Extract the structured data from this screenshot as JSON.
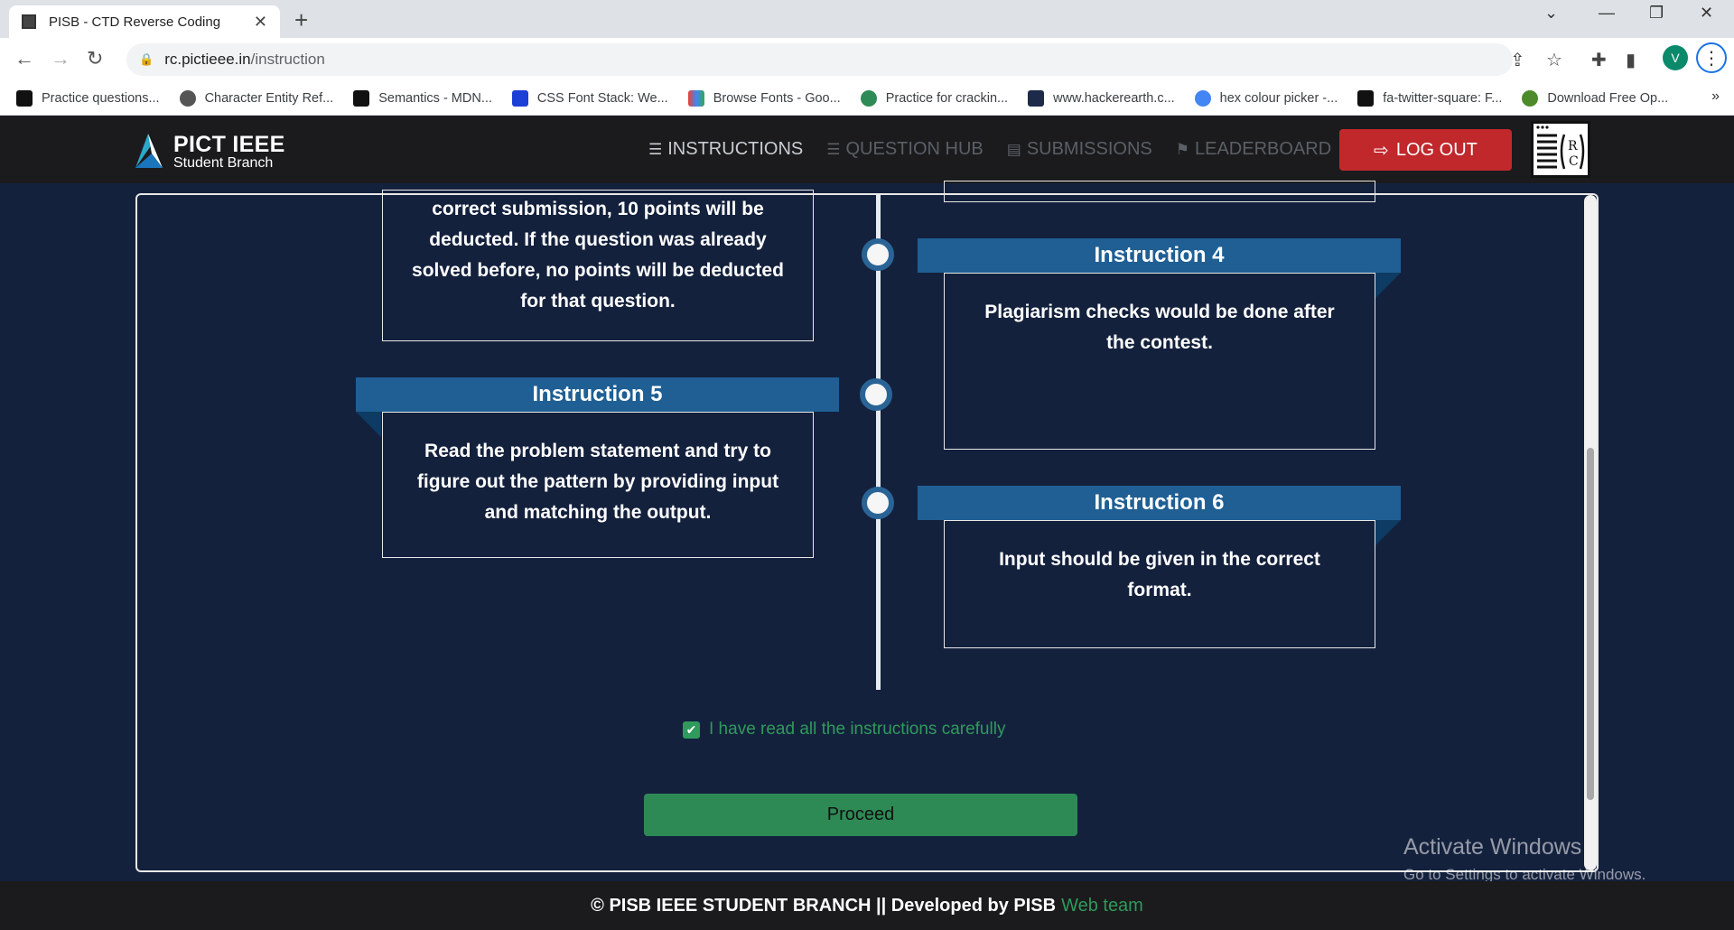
{
  "browser": {
    "tab_title": "PISB - CTD Reverse Coding",
    "url_host": "rc.pictieee.in",
    "url_path": "/instruction",
    "profile_initial": "V",
    "bookmarks": [
      "Practice questions...",
      "Character Entity Ref...",
      "Semantics - MDN...",
      "CSS Font Stack: We...",
      "Browse Fonts - Goo...",
      "Practice for crackin...",
      "www.hackerearth.c...",
      "hex colour picker -...",
      "fa-twitter-square: F...",
      "Download Free Op..."
    ]
  },
  "navbar": {
    "logo_line1": "PICT IEEE",
    "logo_line2": "Student Branch",
    "links": [
      "INSTRUCTIONS",
      "QUESTION HUB",
      "SUBMISSIONS",
      "LEADERBOARD"
    ],
    "logout_label": "LOG OUT",
    "rc_logo_text": "R C"
  },
  "instructions": {
    "prev_text": "correct submission, 10 points will be deducted. If the question was already solved before, no points will be deducted for that question.",
    "i4_title": "Instruction 4",
    "i4_text": "Plagiarism checks would be done after the contest.",
    "i5_title": "Instruction 5",
    "i5_text": "Read the problem statement and try to figure out the pattern by providing input and matching the output.",
    "i6_title": "Instruction 6",
    "i6_text": "Input should be given in the correct format."
  },
  "ack_label": "I have read all the instructions carefully",
  "ack_checked": true,
  "proceed_label": "Proceed",
  "footer": {
    "text": "© PISB IEEE STUDENT BRANCH || Developed by PISB",
    "link": "Web team"
  },
  "watermark": {
    "line1": "Activate Windows",
    "line2": "Go to Settings to activate Windows."
  },
  "colors": {
    "background": "#14213d",
    "ribbon": "#1f5f94",
    "accent_green": "#2f9a5b",
    "logout_red": "#c0282c"
  }
}
